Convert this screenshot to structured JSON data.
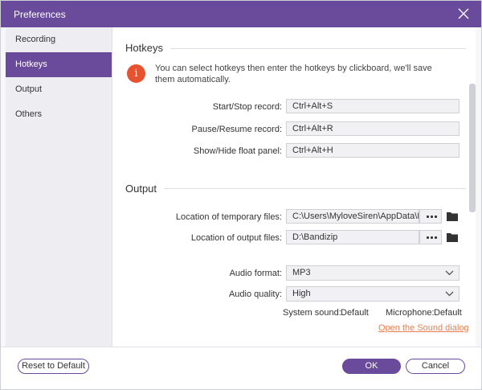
{
  "window": {
    "title": "Preferences"
  },
  "sidebar": {
    "items": [
      {
        "label": "Recording",
        "active": false
      },
      {
        "label": "Hotkeys",
        "active": true
      },
      {
        "label": "Output",
        "active": false
      },
      {
        "label": "Others",
        "active": false
      }
    ]
  },
  "hotkeys": {
    "title": "Hotkeys",
    "info": "You can select hotkeys then enter the hotkeys by clickboard, we'll save them automatically.",
    "rows": [
      {
        "label": "Start/Stop record:",
        "value": "Ctrl+Alt+S"
      },
      {
        "label": "Pause/Resume record:",
        "value": "Ctrl+Alt+R"
      },
      {
        "label": "Show/Hide float panel:",
        "value": "Ctrl+Alt+H"
      }
    ]
  },
  "output": {
    "title": "Output",
    "temp_label": "Location of temporary files:",
    "temp_value": "C:\\Users\\MyloveSiren\\AppData\\Local",
    "out_label": "Location of output files:",
    "out_value": "D:\\Bandizip",
    "audio_format_label": "Audio format:",
    "audio_format_value": "MP3",
    "audio_quality_label": "Audio quality:",
    "audio_quality_value": "High",
    "system_sound_label": "System sound:",
    "system_sound_value": "Default",
    "microphone_label": "Microphone:",
    "microphone_value": "Default",
    "sound_dialog_link": "Open the Sound dialog"
  },
  "footer": {
    "reset_label": "Reset to Default",
    "ok_label": "OK",
    "cancel_label": "Cancel"
  },
  "colors": {
    "accent": "#6a4a9a",
    "info": "#e8532f",
    "link": "#e87c4c"
  },
  "icons": [
    "close-icon",
    "info-icon",
    "more-dots-icon",
    "folder-icon",
    "chevron-down-icon"
  ]
}
